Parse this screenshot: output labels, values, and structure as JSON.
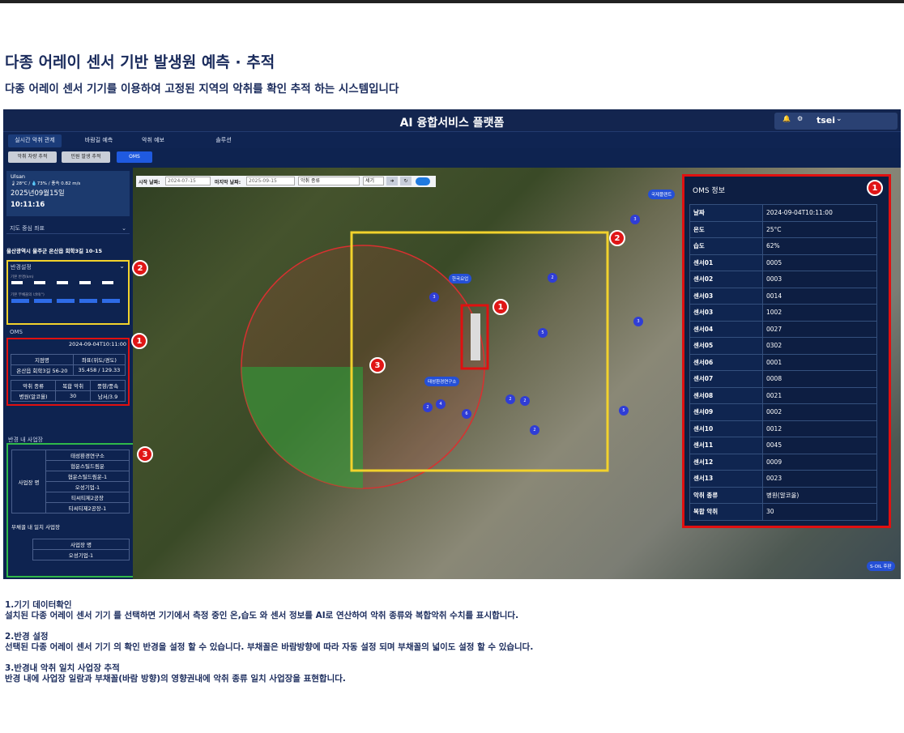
{
  "page": {
    "heading": "다종 어레이 센서 기반 발생원 예측 · 추적",
    "subheading": "다종 어레이 센서 기기를 이용하여 고정된 지역의 악취를 확인 추적 하는 시스템입니다"
  },
  "app": {
    "title": "AI 융합서비스 플랫폼",
    "user": "tsei",
    "nav_tabs": [
      "실시간 악취 관제",
      "바람길 예측",
      "악취 예보",
      "솔루션"
    ],
    "sub_tabs": [
      "악취 차량 추적",
      "민원 발생 추적",
      "OMS"
    ]
  },
  "sidebar": {
    "weather_location": "Ulsan",
    "weather_line": "🌡28°C / 💧73% / 풍속 0.82 m/s",
    "weather_date": "2025년09월15일",
    "weather_time": "10:11:16",
    "map_coord_label": "지도 중심 좌표",
    "address": "울산광역시 울주군 온산읍 회학3길 10-15",
    "radius_label": "반경설정",
    "radius_sub1": "기본 반경(km)",
    "radius_sub2": "기본 부채꼴의 너비(°)",
    "oms_label": "OMS",
    "oms_time": "2024-09-04T10:11:00",
    "oms_table": {
      "headers": [
        "지점명",
        "좌표(위도/경도)"
      ],
      "row": [
        "온산읍 회학3길 56-20",
        "35.458 / 129.33"
      ],
      "headers2": [
        "악취 종류",
        "복합 악취",
        "풍향/풍속"
      ],
      "row2": [
        "병원(알코올)",
        "30",
        "남서/3.9"
      ]
    },
    "business_label": "반경 내 사업장",
    "business_header": "사업장 명",
    "businesses": [
      "태성환경연구소",
      "협운스틸드림운",
      "협운스틸드림운-1",
      "오성기업-1",
      "티씨티제2공장",
      "티씨티제2공장-1"
    ],
    "fan_label": "부채꼴 내 일치 사업장",
    "fan_header": "사업장 명",
    "fan_businesses": [
      "오성기업-1"
    ]
  },
  "filter": {
    "start_label": "시작 날짜:",
    "start_value": "2024-07-15",
    "end_label": "마지막 날짜:",
    "end_value": "2025-09-15",
    "type_value": "악취 종류",
    "intensity_value": "세기"
  },
  "map": {
    "labels": [
      "국제플랜트",
      "한국요업",
      "태성환경연구소",
      "S-OIL 후판"
    ],
    "bubbles": [
      "3",
      "2",
      "3",
      "1",
      "5",
      "2",
      "4",
      "6",
      "2",
      "2",
      "5",
      "2",
      "3"
    ]
  },
  "oms_panel": {
    "title": "OMS 정보",
    "rows": [
      [
        "날짜",
        "2024-09-04T10:11:00"
      ],
      [
        "온도",
        "25°C"
      ],
      [
        "습도",
        "62%"
      ],
      [
        "센서01",
        "0005"
      ],
      [
        "센서02",
        "0003"
      ],
      [
        "센서03",
        "0014"
      ],
      [
        "센서03",
        "1002"
      ],
      [
        "센서04",
        "0027"
      ],
      [
        "센서05",
        "0302"
      ],
      [
        "센서06",
        "0001"
      ],
      [
        "센서07",
        "0008"
      ],
      [
        "센서08",
        "0021"
      ],
      [
        "센서09",
        "0002"
      ],
      [
        "센서10",
        "0012"
      ],
      [
        "센서11",
        "0045"
      ],
      [
        "센서12",
        "0009"
      ],
      [
        "센서13",
        "0023"
      ],
      [
        "악취 종류",
        "병원(알코올)"
      ],
      [
        "복합 악취",
        "30"
      ]
    ]
  },
  "badges": [
    "1",
    "2",
    "3",
    "1",
    "2",
    "3",
    "1"
  ],
  "descriptions": [
    {
      "title": "1.기기 데이터확인",
      "body": "설치된 다종 어레이 센서 기기 를 선택하면 기기에서 측정 중인 온,습도 와 센서 정보를 AI로 연산하여 악취 종류와 복합악취 수치를 표시합니다."
    },
    {
      "title": "2.반경 설정",
      "body": "선택된 다종 어레이 센서 기기 의 확인 반경을 설정 할 수 있습니다. 부채꼴은 바람방향에 따라 자동 설정 되며 부채꼴의 넓이도 설정 할 수 있습니다."
    },
    {
      "title": "3.반경내 악취 일치 사업장 추적",
      "body": "반경 내에 사업장 일람과 부채꼴(바람 방향)의 영향권내에 악취 종류 일치 사업장을 표현합니다."
    }
  ],
  "colors": {
    "panel_red": "#e01010",
    "panel_yellow": "#f2d22c",
    "panel_green": "#2fb84a",
    "app_bg": "#0e2350"
  }
}
